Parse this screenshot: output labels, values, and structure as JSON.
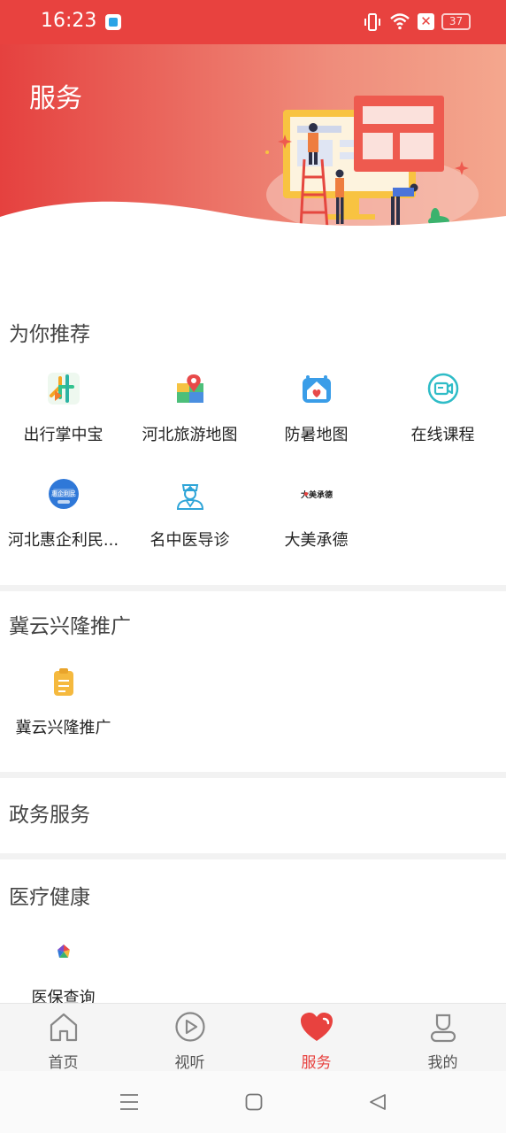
{
  "status_bar": {
    "time": "16:23",
    "battery": "37",
    "sim_icon": "x-icon"
  },
  "header": {
    "title": "服务",
    "background_colors": [
      "#e5413f",
      "#f4a78e"
    ]
  },
  "sections": [
    {
      "title": "为你推荐",
      "items": [
        {
          "label": "出行掌中宝",
          "icon": "metro-map-icon"
        },
        {
          "label": "河北旅游地图",
          "icon": "map-pin-icon"
        },
        {
          "label": "防暑地图",
          "icon": "house-heart-icon"
        },
        {
          "label": "在线课程",
          "icon": "video-camera-icon"
        },
        {
          "label": "河北惠企利民...",
          "icon": "hebei-badge-icon"
        },
        {
          "label": "名中医导诊",
          "icon": "doctor-icon"
        },
        {
          "label": "大美承德",
          "icon": "chengde-logo-icon"
        }
      ]
    },
    {
      "title": "冀云兴隆推广",
      "items": [
        {
          "label": "冀云兴隆推广",
          "icon": "clipboard-icon"
        }
      ]
    },
    {
      "title": "政务服务",
      "items": []
    },
    {
      "title": "医疗健康",
      "items": [
        {
          "label": "医保查询",
          "icon": "medical-insurance-icon"
        }
      ]
    }
  ],
  "chengde_logo_text": "大美承德",
  "hebei_badge_text": "惠企利民",
  "bottom_nav": [
    {
      "label": "首页",
      "icon": "home-icon",
      "active": false
    },
    {
      "label": "视听",
      "icon": "play-icon",
      "active": false
    },
    {
      "label": "服务",
      "icon": "heart-icon",
      "active": true
    },
    {
      "label": "我的",
      "icon": "user-icon",
      "active": false
    }
  ],
  "colors": {
    "accent": "#e8423f",
    "divider": "#f2f2f2"
  }
}
